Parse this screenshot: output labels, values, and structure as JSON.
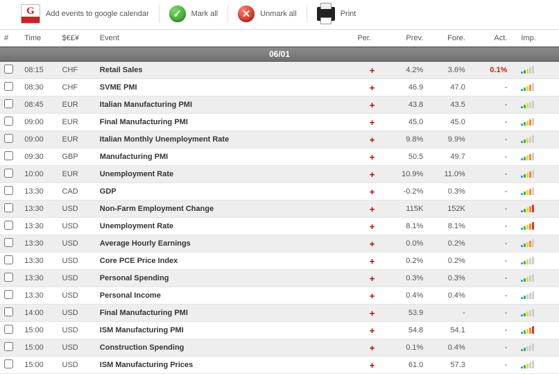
{
  "toolbar": {
    "gcal_label": "Add events to google calendar",
    "mark_all_label": "Mark all",
    "unmark_all_label": "Unmark all",
    "print_label": "Print"
  },
  "headers": {
    "num": "#",
    "time": "Time",
    "currency": "$€£¥",
    "event": "Event",
    "per": "Per.",
    "prev": "Prev.",
    "fore": "Fore.",
    "act": "Act.",
    "imp": "Imp."
  },
  "date_label": "06/01",
  "per_symbol": "+",
  "rows": [
    {
      "time": "08:15",
      "cur": "CHF",
      "event": "Retail Sales",
      "prev": "4.2%",
      "fore": "3.6%",
      "act": "0.1%",
      "act_standout": true,
      "imp": 3
    },
    {
      "time": "08:30",
      "cur": "CHF",
      "event": "SVME PMI",
      "prev": "46.9",
      "fore": "47.0",
      "act": "-",
      "imp": 4
    },
    {
      "time": "08:45",
      "cur": "EUR",
      "event": "Italian Manufacturing PMI",
      "prev": "43.8",
      "fore": "43.5",
      "act": "-",
      "imp": 3
    },
    {
      "time": "09:00",
      "cur": "EUR",
      "event": "Final Manufacturing PMI",
      "prev": "45.0",
      "fore": "45.0",
      "act": "-",
      "imp": 4
    },
    {
      "time": "09:00",
      "cur": "EUR",
      "event": "Italian Monthly Unemployment Rate",
      "prev": "9.8%",
      "fore": "9.9%",
      "act": "-",
      "imp": 3
    },
    {
      "time": "09:30",
      "cur": "GBP",
      "event": "Manufacturing PMI",
      "prev": "50.5",
      "fore": "49.7",
      "act": "-",
      "imp": 4
    },
    {
      "time": "10:00",
      "cur": "EUR",
      "event": "Unemployment Rate",
      "prev": "10.9%",
      "fore": "11.0%",
      "act": "-",
      "imp": 4
    },
    {
      "time": "13:30",
      "cur": "CAD",
      "event": "GDP",
      "prev": "-0.2%",
      "fore": "0.3%",
      "act": "-",
      "imp": 4
    },
    {
      "time": "13:30",
      "cur": "USD",
      "event": "Non-Farm Employment Change",
      "prev": "115K",
      "fore": "152K",
      "act": "-",
      "imp": 5
    },
    {
      "time": "13:30",
      "cur": "USD",
      "event": "Unemployment Rate",
      "prev": "8.1%",
      "fore": "8.1%",
      "act": "-",
      "imp": 5
    },
    {
      "time": "13:30",
      "cur": "USD",
      "event": "Average Hourly Earnings",
      "prev": "0.0%",
      "fore": "0.2%",
      "act": "-",
      "imp": 4
    },
    {
      "time": "13:30",
      "cur": "USD",
      "event": "Core PCE Price Index",
      "prev": "0.2%",
      "fore": "0.2%",
      "act": "-",
      "imp": 3
    },
    {
      "time": "13:30",
      "cur": "USD",
      "event": "Personal Spending",
      "prev": "0.3%",
      "fore": "0.3%",
      "act": "-",
      "imp": 3
    },
    {
      "time": "13:30",
      "cur": "USD",
      "event": "Personal Income",
      "prev": "0.4%",
      "fore": "0.4%",
      "act": "-",
      "imp": 2
    },
    {
      "time": "14:00",
      "cur": "USD",
      "event": "Final Manufacturing PMI",
      "prev": "53.9",
      "fore": "-",
      "act": "-",
      "imp": 3
    },
    {
      "time": "15:00",
      "cur": "USD",
      "event": "ISM Manufacturing PMI",
      "prev": "54.8",
      "fore": "54.1",
      "act": "-",
      "imp": 5
    },
    {
      "time": "15:00",
      "cur": "USD",
      "event": "Construction Spending",
      "prev": "0.1%",
      "fore": "0.4%",
      "act": "-",
      "imp": 2
    },
    {
      "time": "15:00",
      "cur": "USD",
      "event": "ISM Manufacturing Prices",
      "prev": "61.0",
      "fore": "57.3",
      "act": "-",
      "imp": 3
    }
  ]
}
